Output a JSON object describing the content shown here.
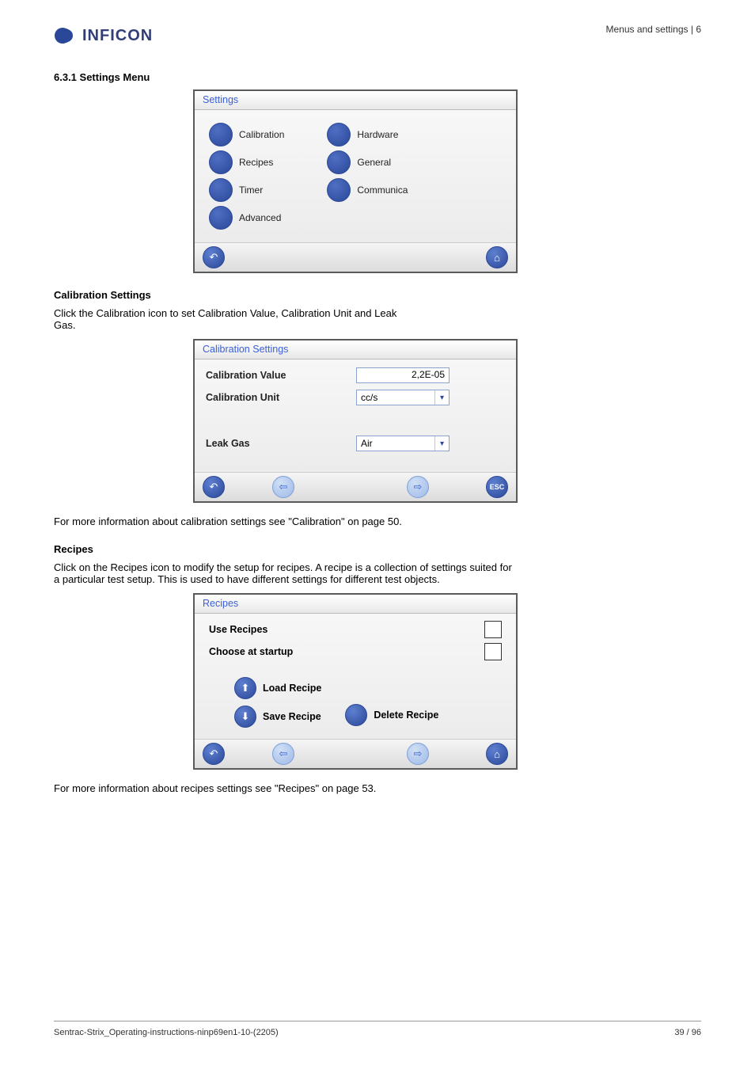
{
  "brand": "INFICON",
  "header_right": "Menus and settings | 6",
  "section_1": {
    "heading": "6.3.1 Settings Menu",
    "panel_title": "Settings",
    "menu_left": [
      "Calibration",
      "Recipes",
      "Timer",
      "Advanced"
    ],
    "menu_right": [
      "Hardware",
      "General",
      "Communica"
    ]
  },
  "calibration": {
    "heading": "Calibration Settings",
    "panel_title": "Calibration Settings",
    "desc": "Click the Calibration icon to set Calibration Value, Calibration Unit and Leak Gas.",
    "rows": {
      "label_value": "Calibration Value",
      "value": "2,2E-05",
      "label_unit": "Calibration Unit",
      "unit": "cc/s",
      "label_gas": "Leak Gas",
      "gas": "Air"
    },
    "more": "For more information about calibration settings see \"Calibration\" on page 50."
  },
  "recipes": {
    "heading": "Recipes",
    "panel_title": "Recipes",
    "desc": "Click on the Recipes icon to modify the setup for recipes. A recipe is a collection of settings suited for a particular test setup. This is used to have different settings for different test objects.",
    "use_recipes": "Use Recipes",
    "choose_startup": "Choose at startup",
    "load": "Load Recipe",
    "save": "Save Recipe",
    "delete": "Delete Recipe",
    "more": "For more information about recipes settings see \"Recipes\" on page 53."
  },
  "footer": {
    "left": "Sentrac-Strix_Operating-instructions-ninp69en1-10-(2205)",
    "right": "39 / 96"
  },
  "icons": {
    "back": "↶",
    "home": "⌂",
    "prev": "⇦",
    "next": "⇨",
    "esc": "ESC",
    "load": "⬆",
    "save": "⬇",
    "chev": "▾"
  }
}
